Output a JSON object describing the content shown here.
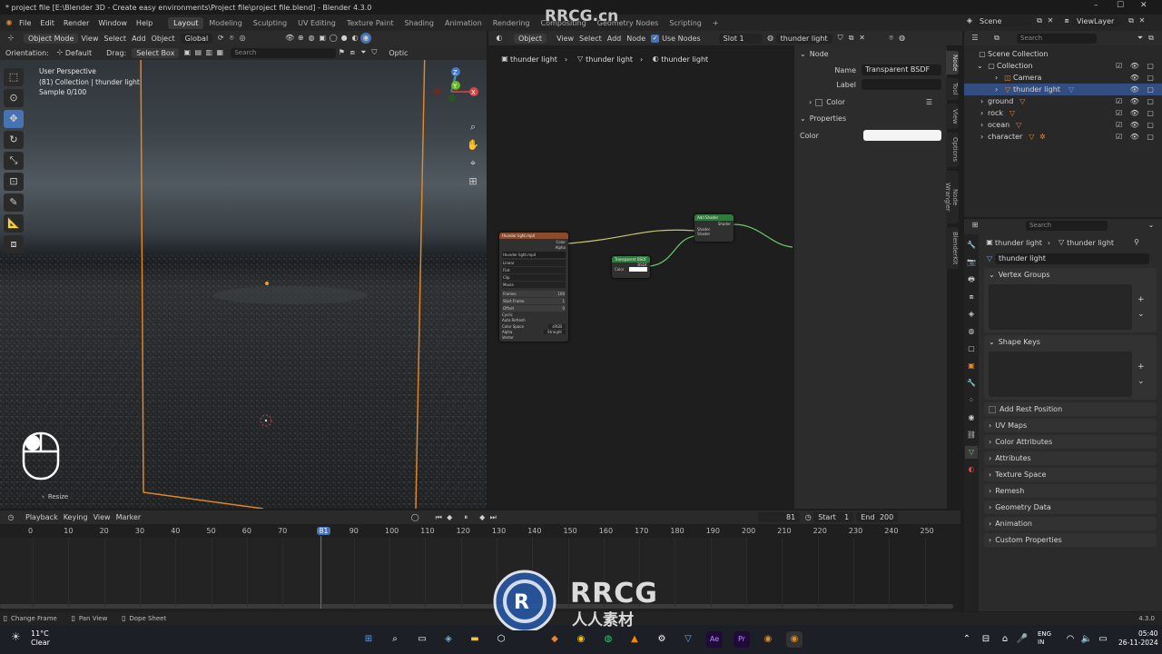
{
  "window": {
    "title": "* project file [E:\\Blender 3D - Create easy environments\\Project file\\project file.blend] - Blender 4.3.0",
    "minimize": "–",
    "maximize": "☐",
    "close": "✕"
  },
  "menu": [
    "File",
    "Edit",
    "Render",
    "Window",
    "Help"
  ],
  "workspaces": [
    "Layout",
    "Modeling",
    "Sculpting",
    "UV Editing",
    "Texture Paint",
    "Shading",
    "Animation",
    "Rendering",
    "Compositing",
    "Geometry Nodes",
    "Scripting"
  ],
  "workspace_add": "+",
  "scene": {
    "label": "Scene",
    "viewlayer": "ViewLayer"
  },
  "viewport_header": {
    "mode": "Object Mode",
    "menus": [
      "View",
      "Select",
      "Add",
      "Object"
    ],
    "transform": "Global"
  },
  "tool_header": {
    "orientation_label": "Orientation:",
    "orientation": "Default",
    "drag_label": "Drag:",
    "drag": "Select Box",
    "search_placeholder": "Search",
    "options": "Optic"
  },
  "viewport": {
    "perspective": "User Perspective",
    "collection": "(81) Collection | thunder light",
    "sample": "Sample 0/100",
    "resize": "Resize",
    "gizmo_x": "X",
    "gizmo_y": "Y",
    "gizmo_z": "Z"
  },
  "node_header": {
    "type": "Object",
    "menus": [
      "View",
      "Select",
      "Add",
      "Node"
    ],
    "use_nodes": "Use Nodes",
    "slot": "Slot 1",
    "material": "thunder light"
  },
  "breadcrumbs": [
    "thunder light",
    "thunder light",
    "thunder light"
  ],
  "nodes": {
    "image": {
      "title": "thunder light.mp4",
      "out_color": "Color",
      "out_alpha": "Alpha",
      "file": "thunder light.mp4",
      "interp": "Linear",
      "proj": "Flat",
      "ext": "Clip",
      "source": "Movie",
      "frames": "Frames",
      "frames_val": "100",
      "start": "Start Frame",
      "start_val": "1",
      "offset": "Offset",
      "offset_val": "0",
      "cyclic": "Cyclic",
      "autorefresh": "Auto Refresh",
      "colorspace": "Color Space",
      "colorspace_val": "sRGB",
      "alpha": "Alpha",
      "alpha_val": "Straight",
      "vector": "Vector"
    },
    "transparent": {
      "title": "Transparent BSDF",
      "out": "BSDF",
      "color": "Color"
    },
    "add_shader": {
      "title": "Add Shader",
      "out": "Shader",
      "in1": "Shader",
      "in2": "Shader"
    }
  },
  "npanel": {
    "node_title": "Node",
    "name_label": "Name",
    "name": "Transparent BSDF",
    "label_label": "Label",
    "color_label": "Color",
    "properties": "Properties",
    "color_prop": "Color",
    "tabs": [
      "Node",
      "Tool",
      "View",
      "Options",
      "Node Wrangler",
      "BlenderKit"
    ]
  },
  "outliner": {
    "search_placeholder": "Search",
    "items": [
      {
        "name": "Scene Collection",
        "indent": 0
      },
      {
        "name": "Collection",
        "indent": 1
      },
      {
        "name": "Camera",
        "indent": 2
      },
      {
        "name": "thunder light",
        "indent": 2,
        "selected": true
      },
      {
        "name": "ground",
        "indent": 1
      },
      {
        "name": "rock",
        "indent": 1
      },
      {
        "name": "ocean",
        "indent": 1
      },
      {
        "name": "character",
        "indent": 1
      }
    ]
  },
  "properties": {
    "search_placeholder": "Search",
    "crumb1": "thunder light",
    "crumb2": "thunder light",
    "data_name": "thunder light",
    "panels": [
      "Vertex Groups",
      "Shape Keys"
    ],
    "add_rest_position": "Add Rest Position",
    "collapsed": [
      "UV Maps",
      "Color Attributes",
      "Attributes",
      "Texture Space",
      "Remesh",
      "Geometry Data",
      "Animation",
      "Custom Properties"
    ]
  },
  "timeline": {
    "menus": [
      "Playback",
      "Keying",
      "View",
      "Marker"
    ],
    "current_frame": "81",
    "start_label": "Start",
    "start": "1",
    "end_label": "End",
    "end": "200",
    "ticks": [
      "0",
      "10",
      "20",
      "30",
      "40",
      "50",
      "60",
      "70",
      "81",
      "90",
      "100",
      "110",
      "120",
      "130",
      "140",
      "150",
      "160",
      "170",
      "180",
      "190",
      "200",
      "210",
      "220",
      "230",
      "240",
      "250"
    ]
  },
  "statusbar": {
    "change_frame": "Change Frame",
    "pan_view": "Pan View",
    "dope_sheet": "Dope Sheet",
    "version": "4.3.0"
  },
  "taskbar": {
    "temp": "11°C",
    "weather": "Clear",
    "lang1": "ENG",
    "lang2": "IN",
    "time": "05:40",
    "date": "26-11-2024"
  },
  "watermarks": {
    "top": "RRCG.cn",
    "logo_text": "RRCG",
    "logo_sub": "人人素材"
  }
}
